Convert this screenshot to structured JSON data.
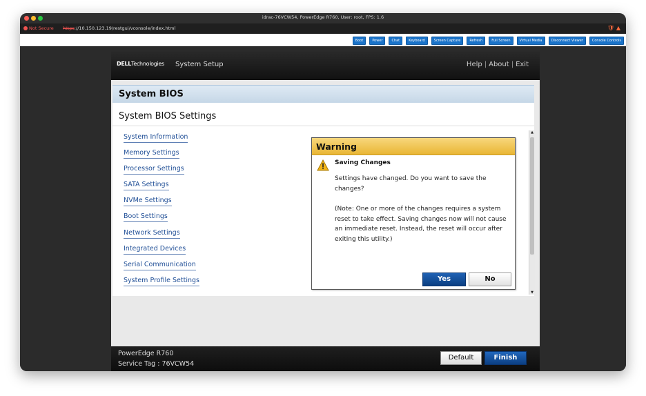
{
  "window": {
    "title": "idrac-76VCW54, PowerEdge R760, User: root, FPS: 1.6"
  },
  "browser": {
    "not_secure": "Not Secure",
    "url_scheme": "https",
    "url_rest": "://10.150.123.19/restgui/vconsole/index.html"
  },
  "toolbar": {
    "buttons": [
      "Boot",
      "Power",
      "Chat",
      "Keyboard",
      "Screen Capture",
      "Refresh",
      "Full Screen",
      "Virtual Media",
      "Disconnect Viewer",
      "Console Controls"
    ]
  },
  "bios": {
    "logo_brand": "DELL",
    "logo_suffix": "Technologies",
    "header_title": "System Setup",
    "help": "Help",
    "about": "About",
    "exit": "Exit",
    "page_title": "System BIOS",
    "section_title": "System BIOS Settings",
    "menu": [
      "System Information",
      "Memory Settings",
      "Processor Settings",
      "SATA Settings",
      "NVMe Settings",
      "Boot Settings",
      "Network Settings",
      "Integrated Devices",
      "Serial Communication",
      "System Profile Settings"
    ]
  },
  "dialog": {
    "title": "Warning",
    "subtitle": "Saving Changes",
    "message": "Settings have changed. Do you want to save the changes?",
    "note": "(Note: One or more of the changes requires a system reset to take effect. Saving changes now will not cause an immediate reset. Instead, the reset will occur after exiting this utility.)",
    "yes": "Yes",
    "no": "No"
  },
  "footer": {
    "model": "PowerEdge R760",
    "service_tag": "Service Tag : 76VCW54",
    "default_button": "Default",
    "finish_button": "Finish"
  },
  "colors": {
    "accent_blue": "#1a73c9",
    "warning_header": "#e9b635",
    "link_blue": "#1f4e96"
  }
}
